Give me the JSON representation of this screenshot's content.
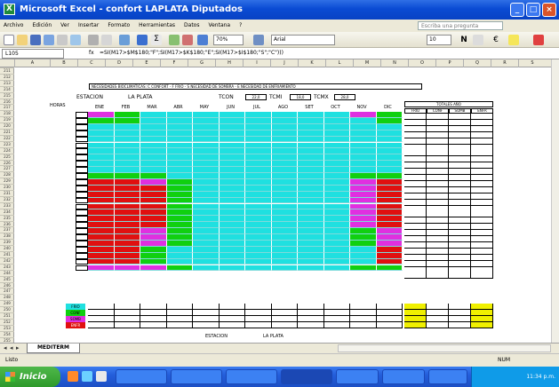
{
  "window": {
    "title": "Microsoft Excel - confort LAPLATA Diputados"
  },
  "menu": {
    "items": [
      "Archivo",
      "Edición",
      "Ver",
      "Insertar",
      "Formato",
      "Herramientas",
      "Datos",
      "Ventana",
      "?"
    ],
    "help_placeholder": "Escriba una pregunta"
  },
  "toolbar": {
    "zoom": "70%",
    "font": "Arial",
    "size": "10"
  },
  "formula_bar": {
    "name_box": "L105",
    "fx": "fx",
    "formula": "=SI(M17>$M$180;\"F\";SI(M17>$K$180;\"E\";SI(M17>$I$180;\"S\";\"C\")))"
  },
  "columns": [
    "A",
    "B",
    "C",
    "D",
    "E",
    "F",
    "G",
    "H",
    "I",
    "J",
    "K",
    "L",
    "M",
    "N",
    "O",
    "P",
    "Q",
    "R",
    "S"
  ],
  "rows": [
    "211",
    "212",
    "213",
    "214",
    "215",
    "216",
    "217",
    "218",
    "219",
    "220",
    "221",
    "222",
    "223",
    "224",
    "225",
    "226",
    "227",
    "228",
    "229",
    "230",
    "231",
    "232",
    "233",
    "234",
    "235",
    "236",
    "237",
    "238",
    "239",
    "240",
    "241",
    "242",
    "243",
    "244",
    "245",
    "246",
    "247",
    "248",
    "249",
    "250",
    "251",
    "252",
    "253",
    "254",
    "255"
  ],
  "sheet": {
    "header_line": "NECESIDADES BIOCLIMATICAS: C CONFORT - F FRIO - S NECESIDAD DE SOMBRA - E NECESIDAD DE ENFRIAMIENTO",
    "station_label": "ESTACION",
    "station_value": "LA PLATA",
    "tcon_label": "TCON",
    "tcon_value": "22,0",
    "tcmi_label": "TCMI",
    "tcmi_value": "18,0",
    "tcmx_label": "TCMX",
    "tcmx_value": "28,0",
    "hours_label": "HORAS",
    "months": [
      "ENE",
      "FEB",
      "MAR",
      "ABR",
      "MAY",
      "JUN",
      "JUL",
      "AGO",
      "SET",
      "OCT",
      "NOV",
      "DIC"
    ],
    "totals_title": "TOTALES AÑO",
    "totals_headers": [
      "FRIO",
      "CONF",
      "SOMB",
      "ENFR"
    ],
    "bottom_labels": [
      "FRIO",
      "CONF",
      "SOMB",
      "ENFR"
    ],
    "bottom_station_label": "ESTACION",
    "bottom_station_value": "LA PLATA",
    "colors": {
      "cyan": "#1fe0e0",
      "red": "#e01010",
      "green": "#10d010",
      "magenta": "#e030e0",
      "yellow": "#f0f000"
    }
  },
  "tabs": {
    "active": "MEDITERM"
  },
  "status": {
    "left": "Listo",
    "right": "NUM"
  },
  "taskbar": {
    "start": "Inicio",
    "clock": "11:34 p.m."
  }
}
